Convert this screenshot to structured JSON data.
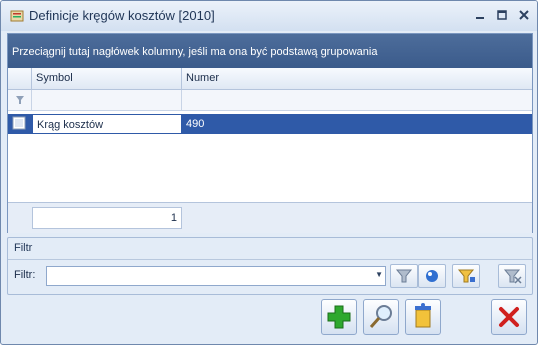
{
  "window": {
    "title": "Definicje kręgów kosztów [2010]",
    "controls": [
      "minimize",
      "maximize",
      "close"
    ]
  },
  "grid": {
    "group_by_hint": "Przeciągnij tutaj nagłówek kolumny, jeśli ma ona być podstawą grupowania",
    "columns": [
      "Symbol",
      "Numer"
    ],
    "rows": [
      {
        "symbol": "Krąg kosztów",
        "numer": "490"
      }
    ],
    "record_count": "1",
    "selection_color": "#2f5aa8"
  },
  "filter_panel": {
    "title": "Filtr",
    "label": "Filtr:",
    "value": ""
  },
  "icons": {
    "app": "ledger-icon",
    "filter": "funnel-icon",
    "add": "plus-icon",
    "edit": "magnifier-icon",
    "delete": "trash-icon",
    "cancel": "x-icon"
  }
}
